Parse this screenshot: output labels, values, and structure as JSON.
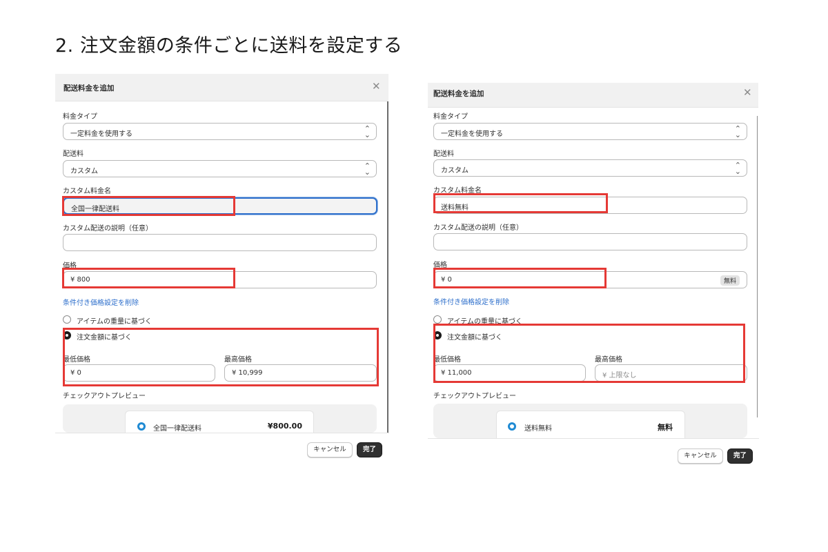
{
  "heading": "2. 注文金額の条件ごとに送料を設定する",
  "dialog_title": "配送料金を追加",
  "close_symbol": "✕",
  "labels": {
    "rate_type": "料金タイプ",
    "shipping_rate": "配送料",
    "custom_name": "カスタム料金名",
    "custom_description": "カスタム配送の説明（任意）",
    "price": "価格",
    "remove_condition": "条件付き価格設定を削除",
    "based_on_weight": "アイテムの重量に基づく",
    "based_on_order_price": "注文金額に基づく",
    "min_price": "最低価格",
    "max_price": "最高価格",
    "checkout_preview": "チェックアウトプレビュー"
  },
  "buttons": {
    "cancel": "キャンセル",
    "done": "完了"
  },
  "left": {
    "rate_type_value": "一定料金を使用する",
    "shipping_rate_value": "カスタム",
    "custom_name_value": "全国一律配送料",
    "price_value": "¥  800",
    "min_value": "¥  0",
    "max_value": "¥  10,999",
    "preview_name": "全国一律配送料",
    "preview_price": "¥800.00"
  },
  "right": {
    "rate_type_value": "一定料金を使用する",
    "shipping_rate_value": "カスタム",
    "custom_name_value": "送料無料",
    "price_value": "¥  0",
    "price_badge": "無料",
    "min_value": "¥  11,000",
    "max_placeholder": "¥  上限なし",
    "preview_name": "送料無料",
    "preview_price": "無料"
  },
  "icons": {
    "select_chevron": "up-down-chevron-icon",
    "close": "close-icon",
    "radio_selected": "radio-selected-icon"
  },
  "colors": {
    "highlight": "#e53935",
    "link": "#2c6ecb",
    "primary_button": "#303030",
    "preview_radio": "#1f8ad3"
  }
}
